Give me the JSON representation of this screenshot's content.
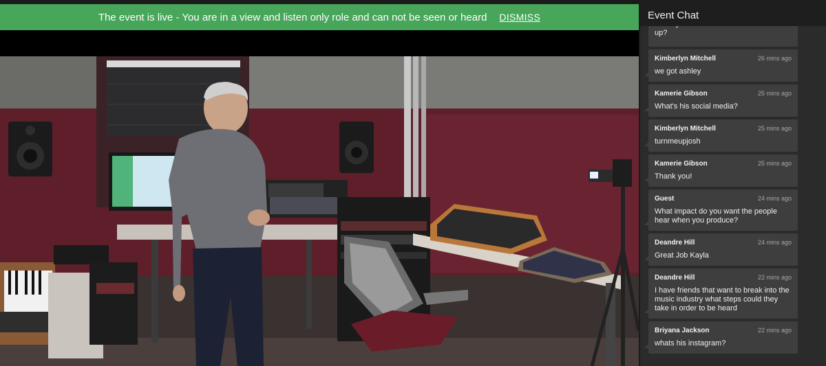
{
  "banner": {
    "message": "The event is live - You are in a view and listen only role and can not be seen or heard",
    "dismiss_label": "DISMISS",
    "color": "#47a65a"
  },
  "video": {
    "description_icon": "studio-video-feed"
  },
  "chat": {
    "title": "Event Chat",
    "partial_message": {
      "text": "already established and want to switch it up?"
    },
    "messages": [
      {
        "author": "Kimberlyn Mitchell",
        "time": "26 mins ago",
        "text": "we got ashley"
      },
      {
        "author": "Kamerie Gibson",
        "time": "25 mins ago",
        "text": "What's his social media?"
      },
      {
        "author": "Kimberlyn Mitchell",
        "time": "25 mins ago",
        "text": "turnmeupjosh"
      },
      {
        "author": "Kamerie Gibson",
        "time": "25 mins ago",
        "text": "Thank you!"
      },
      {
        "author": "Guest",
        "time": "24 mins ago",
        "text": "What impact do you want the people hear when you produce?"
      },
      {
        "author": "Deandre Hill",
        "time": "24 mins ago",
        "text": "Great Job Kayla"
      },
      {
        "author": "Deandre Hill",
        "time": "22 mins ago",
        "text": "I have friends that want to break into the music industry what steps could they take in order to be heard"
      },
      {
        "author": "Briyana Jackson",
        "time": "22 mins ago",
        "text": "whats his instagram?"
      }
    ]
  }
}
